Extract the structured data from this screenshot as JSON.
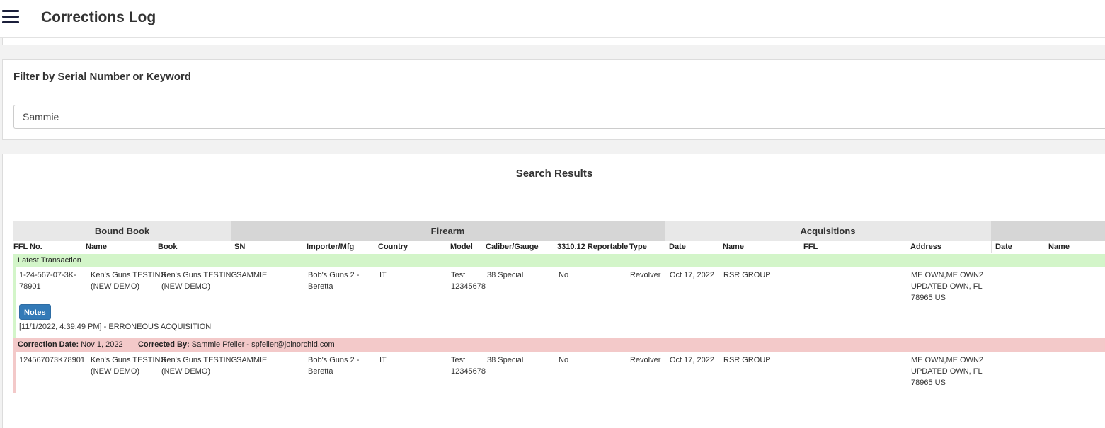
{
  "header": {
    "title": "Corrections Log"
  },
  "filter": {
    "title": "Filter by Serial Number or Keyword",
    "value": "Sammie"
  },
  "results": {
    "title": "Search Results",
    "groups": {
      "bound_book": "Bound Book",
      "firearm": "Firearm",
      "acquisitions": "Acquisitions",
      "dispositions": ""
    },
    "columns": {
      "ffl_no": "FFL No.",
      "name": "Name",
      "book": "Book",
      "sn": "SN",
      "importer": "Importer/Mfg",
      "country": "Country",
      "model": "Model",
      "caliber": "Caliber/Gauge",
      "reportable": "3310.12 Reportable",
      "type": "Type",
      "acq_date": "Date",
      "acq_name": "Name",
      "acq_ffl": "FFL",
      "acq_address": "Address",
      "disp_date": "Date",
      "disp_name": "Name"
    },
    "latest": {
      "label": "Latest Transaction",
      "ffl_no_l1": "1-24-567-07-3K-",
      "ffl_no_l2": "78901",
      "name_l1": "Ken's Guns TESTING",
      "name_l2": "(NEW DEMO)",
      "book_l1": "Ken's Guns TESTING",
      "book_l2": "(NEW DEMO)",
      "sn": "SAMMIE",
      "importer_l1": "Bob's Guns 2 -",
      "importer_l2": "Beretta",
      "country": "IT",
      "model_l1": "Test",
      "model_l2": "12345678",
      "caliber": "38 Special",
      "reportable": "No",
      "type": "Revolver",
      "acq_date": "Oct 17, 2022",
      "acq_name": "RSR GROUP",
      "acq_address_l1": "ME OWN,ME OWN2",
      "acq_address_l2": "UPDATED OWN, FL",
      "acq_address_l3": "78965 US",
      "notes_button": "Notes",
      "note": "[11/1/2022, 4:39:49 PM] - ERRONEOUS ACQUISITION"
    },
    "correction": {
      "date_label": "Correction Date:",
      "date": "Nov 1, 2022",
      "by_label": "Corrected By:",
      "by": "Sammie Pfeller - spfeller@joinorchid.com",
      "ffl_no": "124567073K78901",
      "name_l1": "Ken's Guns TESTING",
      "name_l2": "(NEW DEMO)",
      "book_l1": "Ken's Guns TESTING",
      "book_l2": "(NEW DEMO)",
      "sn": "SAMMIE",
      "importer_l1": "Bob's Guns 2 -",
      "importer_l2": "Beretta",
      "country": "IT",
      "model_l1": "Test",
      "model_l2": "12345678",
      "caliber": "38 Special",
      "reportable": "No",
      "type": "Revolver",
      "acq_date": "Oct 17, 2022",
      "acq_name": "RSR GROUP",
      "acq_address_l1": "ME OWN,ME OWN2",
      "acq_address_l2": "UPDATED OWN, FL",
      "acq_address_l3": "78965 US"
    },
    "colors": {
      "latest_band": "#d3f5c9",
      "correction_band": "#f3c9c9",
      "notes_button": "#337ab7"
    }
  }
}
